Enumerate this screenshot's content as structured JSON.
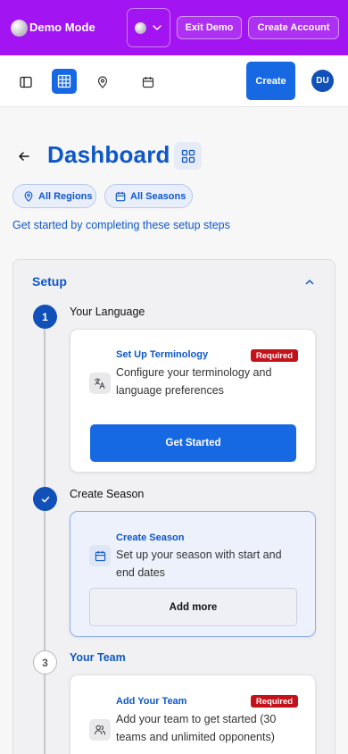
{
  "demo_bar": {
    "title": "Demo Mode",
    "exit_label": "Exit Demo",
    "create_account_label": "Create Account",
    "color": "#a214f2"
  },
  "toolbar": {
    "create_label": "Create",
    "avatar_initials": "DU",
    "icons": [
      "sidebar-icon",
      "grid-icon",
      "location-pin-icon",
      "calendar-icon"
    ],
    "accent": "#1769e3"
  },
  "page": {
    "title": "Dashboard",
    "subtitle": "Get started by completing these setup steps",
    "filters": {
      "regions": "All Regions",
      "seasons": "All Seasons"
    }
  },
  "setup": {
    "header": "Setup",
    "steps": [
      {
        "marker": "1",
        "title": "Your Language",
        "card_title": "Set Up Terminology",
        "badge": "Required",
        "description": "Configure your terminology and language preferences",
        "action": "Get Started",
        "icon": "translate-icon"
      },
      {
        "marker": "check",
        "title": "Create Season",
        "card_title": "Create Season",
        "description": "Set up your season with start and end dates",
        "action": "Add more",
        "icon": "calendar-icon"
      },
      {
        "marker": "3",
        "title": "Your Team",
        "card_title": "Add Your Team",
        "badge": "Required",
        "description": "Add your team to get started (30 teams and unlimited opponents)",
        "icon": "users-icon"
      }
    ]
  }
}
